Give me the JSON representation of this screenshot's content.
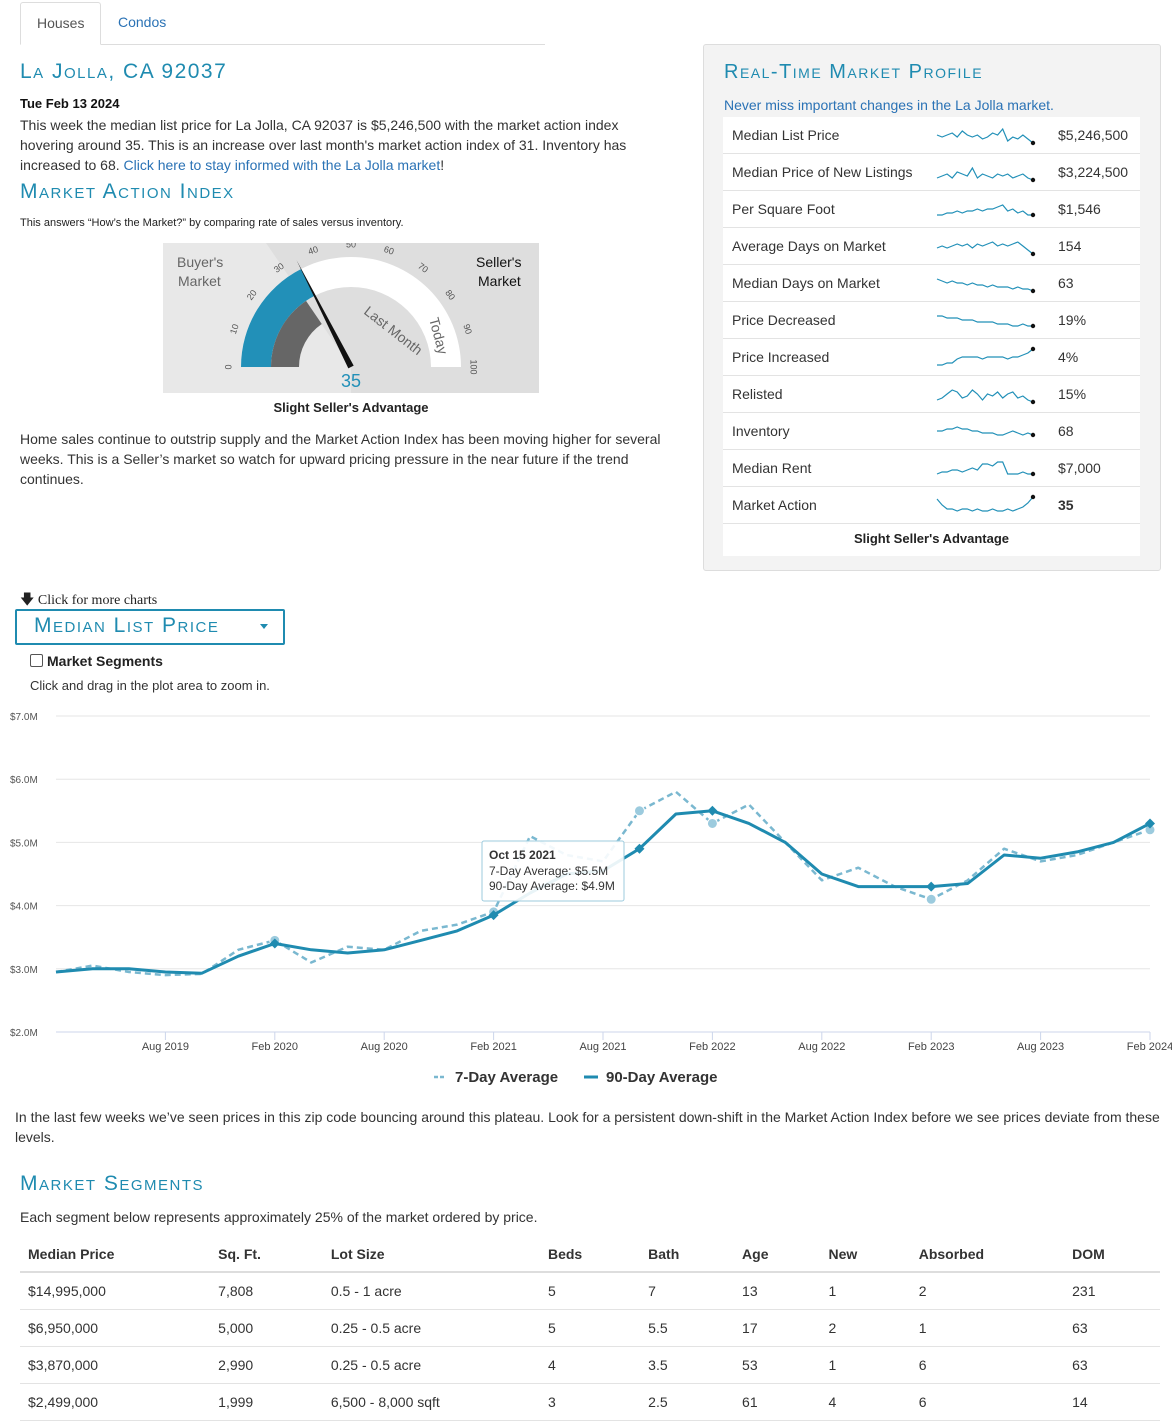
{
  "tabs": [
    {
      "label": "Houses"
    },
    {
      "label": "Condos"
    }
  ],
  "location_title": "La Jolla, CA 92037",
  "date": "Tue Feb 13 2024",
  "intro_text": "This week the median list price for La Jolla, CA 92037 is $5,246,500 with the market action index hovering around 35. This is an increase over last month's market action index of 31. Inventory has increased to 68.",
  "intro_link": "Click here to stay informed with the La Jolla market",
  "intro_end": "!",
  "mai": {
    "title": "Market Action Index",
    "subtitle": "This answers “How’s the Market?” by comparing rate of sales versus inventory.",
    "buyers_label_1": "Buyer's",
    "buyers_label_2": "Market",
    "sellers_label_1": "Seller's",
    "sellers_label_2": "Market",
    "ticks": [
      "0",
      "10",
      "20",
      "30",
      "40",
      "50",
      "60",
      "70",
      "80",
      "90",
      "100"
    ],
    "last_month_label": "Last Month",
    "today_label": "Today",
    "value": 35,
    "last_month_value": 31,
    "caption": "Slight Seller's Advantage",
    "paragraph": "Home sales continue to outstrip supply and the Market Action Index has been moving higher for several weeks. This is a Seller’s market so watch for upward pricing pressure in the near future if the trend continues."
  },
  "profile": {
    "title": "Real-Time Market Profile",
    "subtitle": "Never miss important changes in the La Jolla market.",
    "rows": [
      {
        "label": "Median List Price",
        "value": "$5,246,500"
      },
      {
        "label": "Median Price of New Listings",
        "value": "$3,224,500"
      },
      {
        "label": "Per Square Foot",
        "value": "$1,546"
      },
      {
        "label": "Average Days on Market",
        "value": "154"
      },
      {
        "label": "Median Days on Market",
        "value": "63"
      },
      {
        "label": "Price Decreased",
        "value": "19%"
      },
      {
        "label": "Price Increased",
        "value": "4%"
      },
      {
        "label": "Relisted",
        "value": "15%"
      },
      {
        "label": "Inventory",
        "value": "68"
      },
      {
        "label": "Median Rent",
        "value": "$7,000"
      },
      {
        "label": "Market Action",
        "value": "35"
      }
    ],
    "footer": "Slight Seller's Advantage"
  },
  "more_charts": "Click for more charts",
  "chart_dropdown": "Median List Price",
  "segments_checkbox": "Market Segments",
  "zoom_hint": "Click and drag in the plot area to zoom in.",
  "chart_data": {
    "type": "line",
    "ylim": [
      2.0,
      7.0
    ],
    "yticks": [
      "$2.0M",
      "$3.0M",
      "$4.0M",
      "$5.0M",
      "$6.0M",
      "$7.0M"
    ],
    "xticks": [
      "Aug 2019",
      "Feb 2020",
      "Aug 2020",
      "Feb 2021",
      "Aug 2021",
      "Feb 2022",
      "Aug 2022",
      "Feb 2023",
      "Aug 2023",
      "Feb 2024"
    ],
    "x": [
      "Feb 2019",
      "Apr 2019",
      "Jun 2019",
      "Aug 2019",
      "Oct 2019",
      "Dec 2019",
      "Feb 2020",
      "Apr 2020",
      "Jun 2020",
      "Aug 2020",
      "Oct 2020",
      "Dec 2020",
      "Feb 2021",
      "Apr 2021",
      "Jun 2021",
      "Aug 2021",
      "Oct 2021",
      "Dec 2021",
      "Feb 2022",
      "Apr 2022",
      "Jun 2022",
      "Aug 2022",
      "Oct 2022",
      "Dec 2022",
      "Feb 2023",
      "Apr 2023",
      "Jun 2023",
      "Aug 2023",
      "Oct 2023",
      "Dec 2023",
      "Feb 2024"
    ],
    "series": [
      {
        "name": "7-Day Average",
        "style": "dashed",
        "color": "#7ab8d0",
        "values": [
          2.95,
          3.05,
          2.95,
          2.9,
          2.92,
          3.3,
          3.45,
          3.1,
          3.35,
          3.3,
          3.6,
          3.7,
          3.9,
          5.1,
          4.8,
          4.7,
          5.5,
          5.8,
          5.3,
          5.6,
          5.0,
          4.4,
          4.6,
          4.3,
          4.1,
          4.4,
          4.9,
          4.7,
          4.8,
          5.0,
          5.2
        ]
      },
      {
        "name": "90-Day Average",
        "style": "solid",
        "color": "#1f8bb0",
        "values": [
          2.95,
          3.0,
          3.0,
          2.95,
          2.93,
          3.2,
          3.4,
          3.3,
          3.25,
          3.3,
          3.45,
          3.6,
          3.85,
          4.2,
          4.5,
          4.55,
          4.9,
          5.45,
          5.5,
          5.3,
          5.0,
          4.5,
          4.3,
          4.3,
          4.3,
          4.35,
          4.8,
          4.75,
          4.85,
          5.0,
          5.3
        ]
      }
    ],
    "tooltip": {
      "date": "Oct 15 2021",
      "line1": "7-Day Average: $5.5M",
      "line2": "90-Day Average: $4.9M"
    }
  },
  "chart_paragraph": "In the last few weeks we’ve seen prices in this zip code bouncing around this plateau. Look for a persistent down-shift in the Market Action Index before we see prices deviate from these levels.",
  "segments": {
    "title": "Market Segments",
    "subtitle": "Each segment below represents approximately 25% of the market ordered by price.",
    "headers": [
      "Median Price",
      "Sq. Ft.",
      "Lot Size",
      "Beds",
      "Bath",
      "Age",
      "New",
      "Absorbed",
      "DOM"
    ],
    "rows": [
      [
        "$14,995,000",
        "7,808",
        "0.5 - 1 acre",
        "5",
        "7",
        "13",
        "1",
        "2",
        "231"
      ],
      [
        "$6,950,000",
        "5,000",
        "0.25 - 0.5 acre",
        "5",
        "5.5",
        "17",
        "2",
        "1",
        "63"
      ],
      [
        "$3,870,000",
        "2,990",
        "0.25 - 0.5 acre",
        "4",
        "3.5",
        "53",
        "1",
        "6",
        "63"
      ],
      [
        "$2,499,000",
        "1,999",
        "6,500 - 8,000 sqft",
        "3",
        "2.5",
        "61",
        "4",
        "6",
        "14"
      ]
    ]
  }
}
